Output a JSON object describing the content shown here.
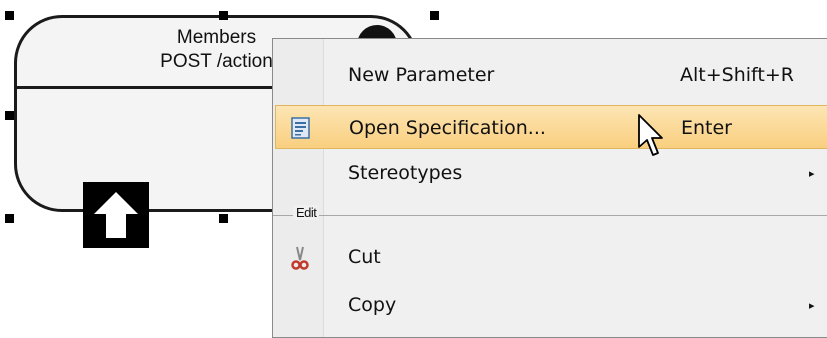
{
  "diagram": {
    "shape_title_line1": "Members",
    "shape_title_line2": "POST /action"
  },
  "context_menu": {
    "items": [
      {
        "label": "New Parameter",
        "shortcut": "Alt+Shift+R",
        "icon": "none"
      },
      {
        "label": "Open Specification...",
        "shortcut": "Enter",
        "icon": "specification-icon",
        "highlighted": true
      },
      {
        "label": "Stereotypes",
        "shortcut": "",
        "icon": "none",
        "submenu": true
      }
    ],
    "section_edit": "Edit",
    "edit_items": [
      {
        "label": "Cut",
        "icon": "scissors-icon"
      },
      {
        "label": "Copy",
        "icon": "none",
        "submenu": true
      }
    ],
    "submenu_glyph": "▸"
  },
  "colors": {
    "highlight": "#f9cf7f",
    "menu_bg": "#f0f0f0",
    "shape_border": "#1a1a1a"
  }
}
